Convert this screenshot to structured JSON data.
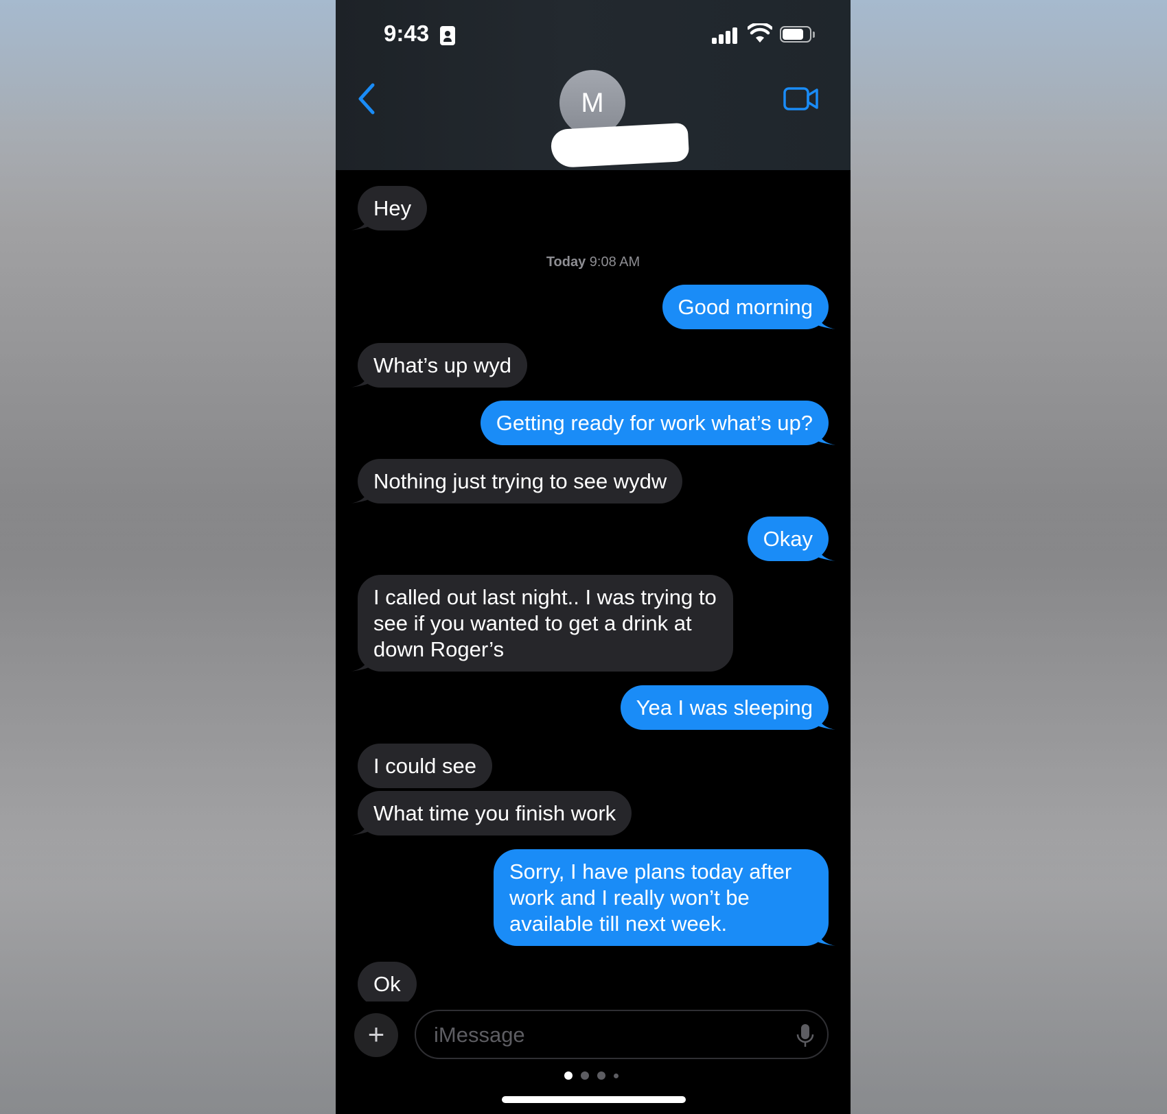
{
  "status_bar": {
    "time": "9:43",
    "battery_level": 0.8,
    "signal_bars": 4
  },
  "header": {
    "avatar_initial": "M",
    "back_icon": "chevron-left-icon",
    "video_icon": "video-camera-icon",
    "accent_color": "#1a8cf7"
  },
  "thread": {
    "timestamp_day": "Today",
    "timestamp_time": "9:08 AM",
    "messages": [
      {
        "sender": "them",
        "text": "Hey"
      },
      {
        "sender": "me",
        "text": "Good morning"
      },
      {
        "sender": "them",
        "text": "What’s up wyd"
      },
      {
        "sender": "me",
        "text": "Getting ready for work what’s up?"
      },
      {
        "sender": "them",
        "text": "Nothing just trying to see wydw"
      },
      {
        "sender": "me",
        "text": "Okay"
      },
      {
        "sender": "them",
        "text": "I called out last night.. I was trying to see if you wanted to get a drink at down Roger’s"
      },
      {
        "sender": "me",
        "text": "Yea I was sleeping"
      },
      {
        "sender": "them",
        "text": "I could see"
      },
      {
        "sender": "them",
        "text": "What time you finish work"
      },
      {
        "sender": "me",
        "text": "Sorry, I have plans today after work and I really won’t be available till next week."
      },
      {
        "sender": "them",
        "text": "Ok"
      }
    ],
    "incoming_color": "#26262a",
    "outgoing_color": "#1a8cf7"
  },
  "composer": {
    "placeholder": "iMessage",
    "value": "",
    "add_icon": "plus-icon",
    "mic_icon": "microphone-icon",
    "page_count": 4,
    "active_page": 1
  }
}
